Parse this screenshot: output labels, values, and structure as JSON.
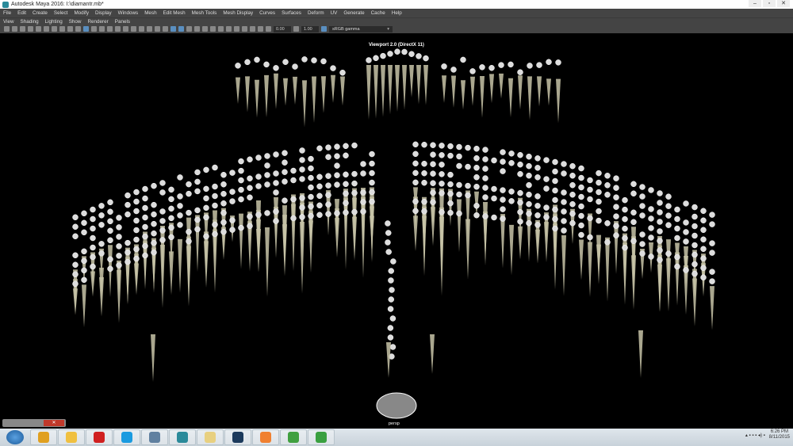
{
  "title": "Autodesk Maya 2016: I:\\diamantr.mb*",
  "menu": [
    "File",
    "Edit",
    "Create",
    "Select",
    "Modify",
    "Display",
    "Windows",
    "Mesh",
    "Edit Mesh",
    "Mesh Tools",
    "Mesh Display",
    "Curves",
    "Surfaces",
    "Deform",
    "UV",
    "Generate",
    "Cache",
    "Help"
  ],
  "panel_menu": [
    "View",
    "Shading",
    "Lighting",
    "Show",
    "Renderer",
    "Panels"
  ],
  "toolbar": {
    "exposure": "0.00",
    "gamma": "1.00",
    "color_space": "sRGB gamma"
  },
  "viewport": {
    "title": "Viewport 2.0 (DirectX 11)",
    "camera": "persp"
  },
  "taskbar": {
    "apps": [
      "chrome",
      "paint",
      "opera",
      "skype",
      "photos",
      "maya",
      "explorer",
      "photoshop",
      "media-player",
      "download-manager",
      "camtasia"
    ],
    "time": "6:26 PM",
    "date": "8/11/2015"
  }
}
